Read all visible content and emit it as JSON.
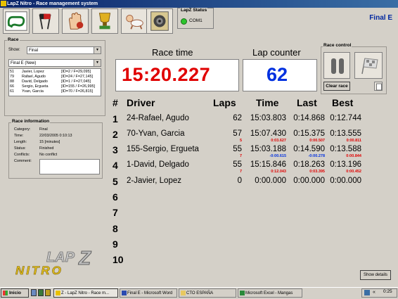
{
  "window": {
    "title": "LapZ Nitro - Race management system"
  },
  "toolbar": {
    "buttons": [
      "race-track-icon",
      "checkered-flags-icon",
      "hand-icon",
      "trophy-icon",
      "crawling-baby-icon",
      "speaker-icon"
    ]
  },
  "status": {
    "title": "LapZ Status",
    "port": "COM1",
    "led_color": "#2cc52c"
  },
  "header": {
    "race_title": "Final E"
  },
  "race_panel": {
    "group_label": "Race",
    "show_label": "Show:",
    "show_value": "Final",
    "race_select_value": "Final E (New)",
    "list": [
      {
        "num": "51",
        "name": "Javier, Lopez",
        "ids": "[ID=2 / F=29,095]"
      },
      {
        "num": "79",
        "name": "Rafael, Agudo",
        "ids": "[ID=24 / F=27,145]"
      },
      {
        "num": "88",
        "name": "David, Delgado",
        "ids": "[ID=1 / F=27,045]"
      },
      {
        "num": "66",
        "name": "Sergio, Ergueta",
        "ids": "[ID=155 / F=26,995]"
      },
      {
        "num": "61",
        "name": "Yvan, Garcia",
        "ids": "[ID=70 / F=26,815]"
      }
    ]
  },
  "race_info": {
    "group_label": "Race information",
    "category_label": "Category:",
    "category": "Final",
    "time_label": "Time:",
    "time": "22/03/2005 0:10:13",
    "length_label": "Length:",
    "length": "15 [minutes]",
    "status_label": "Status:",
    "status": "Finished",
    "conflicts_label": "Conflicts:",
    "conflicts": "No conflict",
    "comment_label": "Comment:"
  },
  "displays": {
    "race_time_label": "Race time",
    "race_time": "15:20.227",
    "lap_counter_label": "Lap counter",
    "lap_counter": "62"
  },
  "race_control": {
    "group_label": "Race control",
    "clear_label": "Clear race"
  },
  "table": {
    "headers": {
      "num": "#",
      "driver": "Driver",
      "laps": "Laps",
      "time": "Time",
      "last": "Last",
      "best": "Best"
    },
    "rows": [
      {
        "pos": "1",
        "driver": "24-Rafael, Agudo",
        "laps": "62",
        "time": "15:03.803",
        "last": "0:14.868",
        "best": "0:12.744",
        "laps_sub": "",
        "time_sub": "",
        "last_sub": "",
        "best_sub": ""
      },
      {
        "pos": "2",
        "driver": "70-Yvan, Garcia",
        "laps": "57",
        "time": "15:07.430",
        "last": "0:15.375",
        "best": "0:13.555",
        "laps_sub": "5",
        "time_sub": "0:03.627",
        "last_sub": "0:00.507",
        "best_sub": "0:00.811"
      },
      {
        "pos": "3",
        "driver": "155-Sergio, Ergueta",
        "laps": "55",
        "time": "15:03.188",
        "last": "0:14.590",
        "best": "0:13.588",
        "laps_sub": "7",
        "time_sub": "-0:00.615",
        "last_sub": "-0:00.278",
        "best_sub": "0:00.844"
      },
      {
        "pos": "4",
        "driver": "1-David, Delgado",
        "laps": "55",
        "time": "15:15.846",
        "last": "0:18.263",
        "best": "0:13.196",
        "laps_sub": "7",
        "time_sub": "0:12.043",
        "last_sub": "0:03.395",
        "best_sub": "0:00.452"
      },
      {
        "pos": "5",
        "driver": "2-Javier, Lopez",
        "laps": "0",
        "time": "0:00.000",
        "last": "0:00.000",
        "best": "0:00.000",
        "laps_sub": "",
        "time_sub": "",
        "last_sub": "",
        "best_sub": ""
      },
      {
        "pos": "6",
        "driver": "",
        "laps": "",
        "time": "",
        "last": "",
        "best": "",
        "laps_sub": "",
        "time_sub": "",
        "last_sub": "",
        "best_sub": ""
      },
      {
        "pos": "7",
        "driver": "",
        "laps": "",
        "time": "",
        "last": "",
        "best": "",
        "laps_sub": "",
        "time_sub": "",
        "last_sub": "",
        "best_sub": ""
      },
      {
        "pos": "8",
        "driver": "",
        "laps": "",
        "time": "",
        "last": "",
        "best": "",
        "laps_sub": "",
        "time_sub": "",
        "last_sub": "",
        "best_sub": ""
      },
      {
        "pos": "9",
        "driver": "",
        "laps": "",
        "time": "",
        "last": "",
        "best": "",
        "laps_sub": "",
        "time_sub": "",
        "last_sub": "",
        "best_sub": ""
      },
      {
        "pos": "10",
        "driver": "",
        "laps": "",
        "time": "",
        "last": "",
        "best": "",
        "laps_sub": "",
        "time_sub": "",
        "last_sub": "",
        "best_sub": ""
      }
    ]
  },
  "logo": {
    "text": "LAPZ NITRO"
  },
  "show_details": "Show details",
  "taskbar": {
    "start_label": "Inicio",
    "tasks": [
      {
        "label": "Z - LapZ Nitro - Race m...",
        "icon": "lapz-icon",
        "active": true
      },
      {
        "label": "Final E - Microsoft Word",
        "icon": "word-icon",
        "active": false
      },
      {
        "label": "CTO ESPAÑA",
        "icon": "folder-icon",
        "active": false
      },
      {
        "label": "Microsoft Excel - Mangas",
        "icon": "excel-icon",
        "active": false
      }
    ],
    "tray_icons": [
      "network-icon",
      "speaker-icon"
    ],
    "clock": "0:25"
  },
  "colors": {
    "accent_blue": "#0028a0",
    "time_red": "#e00000",
    "lap_blue": "#0030e0"
  }
}
